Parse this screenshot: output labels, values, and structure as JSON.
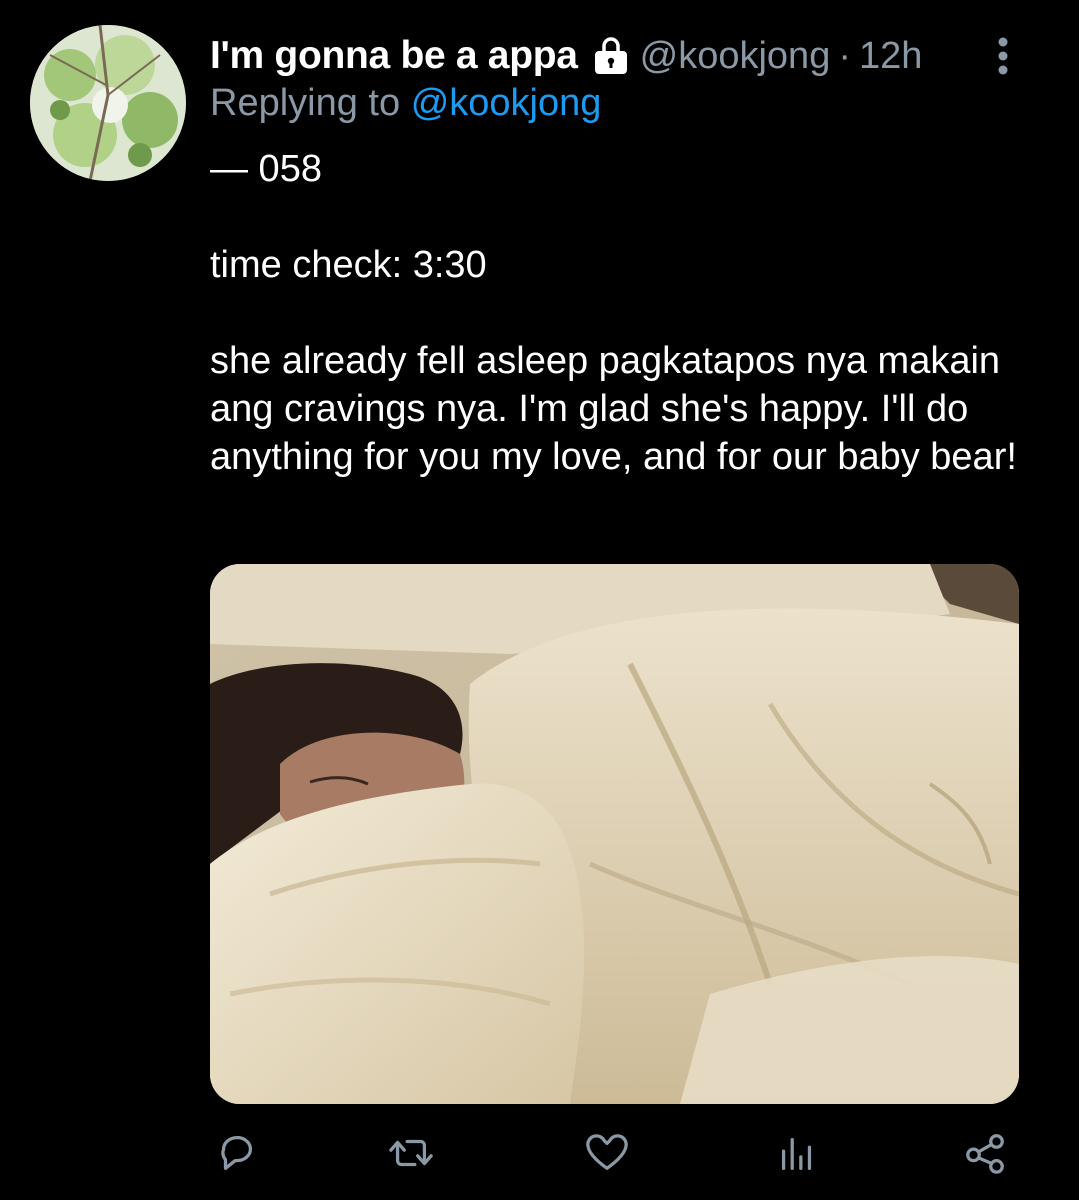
{
  "tweet": {
    "display_name": "I'm gonna be a appa",
    "protected_icon": "lock-icon",
    "handle": "@kookjong",
    "separator": "·",
    "time": "12h",
    "more_icon": "more-vertical-icon",
    "replying_prefix": "Replying to",
    "replying_to": "@kookjong",
    "lines": {
      "line1": "— 058",
      "line2": "time check: 3:30",
      "line3": "she already fell asleep pagkatapos nya makain ang cravings nya. I'm glad she's happy. I'll do anything for you my love, and for our baby bear!"
    }
  },
  "media": {
    "description_icon": "photo-sleeping-person"
  },
  "actions": {
    "reply_icon": "reply-icon",
    "retweet_icon": "retweet-icon",
    "like_icon": "heart-icon",
    "analytics_icon": "analytics-icon",
    "share_icon": "share-icon"
  },
  "colors": {
    "background": "#000000",
    "text_primary": "#ffffff",
    "text_secondary": "#8b98a5",
    "link": "#1d9bf0"
  }
}
